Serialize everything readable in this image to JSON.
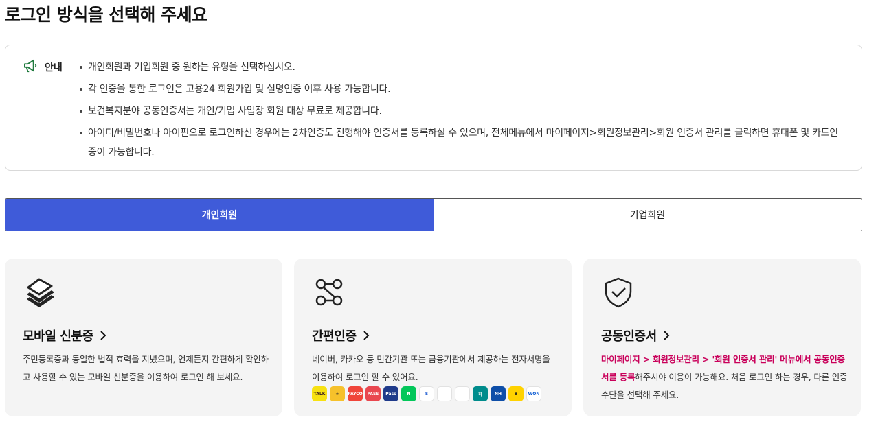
{
  "page": {
    "title": "로그인 방식을 선택해 주세요"
  },
  "notice": {
    "label": "안내",
    "items": [
      "개인회원과 기업회원 중 원하는 유형을 선택하십시오.",
      "각 인증을 통한 로그인은 고용24 회원가입 및 실명인증 이후 사용 가능합니다.",
      "보건복지분야 공동인증서는 개인/기업 사업장 회원 대상 무료로 제공합니다.",
      "아이디/비밀번호나 아이핀으로 로그인하신 경우에는 2차인증도 진행해야 인증서를 등록하실 수 있으며, 전체메뉴에서 마이페이지>회원정보관리>회원 인증서 관리를 클릭하면 휴대폰 및 카드인증이 가능합니다."
    ]
  },
  "tabs": [
    {
      "label": "개인회원",
      "active": true
    },
    {
      "label": "기업회원",
      "active": false
    }
  ],
  "cards": {
    "mobile_id": {
      "title": "모바일 신분증",
      "desc": "주민등록증과 동일한 법적 효력을 지녔으며, 언제든지 간편하게 확인하고 사용할 수 있는 모바일 신분증을 이용하여 로그인 해 보세요."
    },
    "easy_auth": {
      "title": "간편인증",
      "desc": "네이버, 카카오 등 민간기관 또는 금융기관에서 제공하는 전자서명을 이용하여 로그인 할 수 있어요.",
      "providers": [
        {
          "name": "kakao-logo-icon",
          "text": "TALK",
          "bg": "#f7e111",
          "fg": "#3c1e1e"
        },
        {
          "name": "kb-star-logo-icon",
          "text": "★",
          "bg": "#f6c12b",
          "fg": "#5a4a2a"
        },
        {
          "name": "payco-logo-icon",
          "text": "PAYCO",
          "bg": "#f0453a",
          "fg": "#ffffff"
        },
        {
          "name": "pass-logo-icon",
          "text": "PASS",
          "bg": "#e9474f",
          "fg": "#ffffff"
        },
        {
          "name": "samsung-pass-logo-icon",
          "text": "Pass",
          "bg": "#1f3a8a",
          "fg": "#ffffff"
        },
        {
          "name": "naver-logo-icon",
          "text": "N",
          "bg": "#03c75a",
          "fg": "#ffffff"
        },
        {
          "name": "shinhan-logo-icon",
          "text": "S",
          "bg": "#ffffff",
          "fg": "#1d5bd1"
        },
        {
          "name": "toss-logo-icon",
          "text": "",
          "bg": "#ffffff",
          "fg": "#1c7cf5"
        },
        {
          "name": "banksalad-logo-icon",
          "text": "",
          "bg": "#ffffff",
          "fg": "#2fbf71"
        },
        {
          "name": "hana-logo-icon",
          "text": "하",
          "bg": "#008c8c",
          "fg": "#ffffff"
        },
        {
          "name": "nh-logo-icon",
          "text": "NH",
          "bg": "#0e4ea8",
          "fg": "#ffffff"
        },
        {
          "name": "kbank-logo-icon",
          "text": "B",
          "bg": "#ffd200",
          "fg": "#1a1a1a"
        },
        {
          "name": "woori-logo-icon",
          "text": "WON",
          "bg": "#ffffff",
          "fg": "#0b5bd3"
        }
      ]
    },
    "joint_cert": {
      "title": "공동인증서",
      "desc_highlight": "마이페이지 > 회원정보관리 > '회원 인증서 관리' 메뉴에서 공동인증서를 등록",
      "desc_rest": "해주셔야 이용이 가능해요. 처음 로그인 하는 경우, 다른 인증 수단을 선택해 주세요."
    }
  },
  "icons": {
    "notice": "megaphone-icon",
    "mobile_id": "layers-icon",
    "easy_auth": "network-icon",
    "joint_cert": "shield-check-icon",
    "chevron": "chevron-right-icon"
  },
  "colors": {
    "primary": "#3f5bd9",
    "highlight": "#c9005a",
    "notice_icon": "#1f7a3d",
    "card_bg": "#f4f4f4"
  }
}
